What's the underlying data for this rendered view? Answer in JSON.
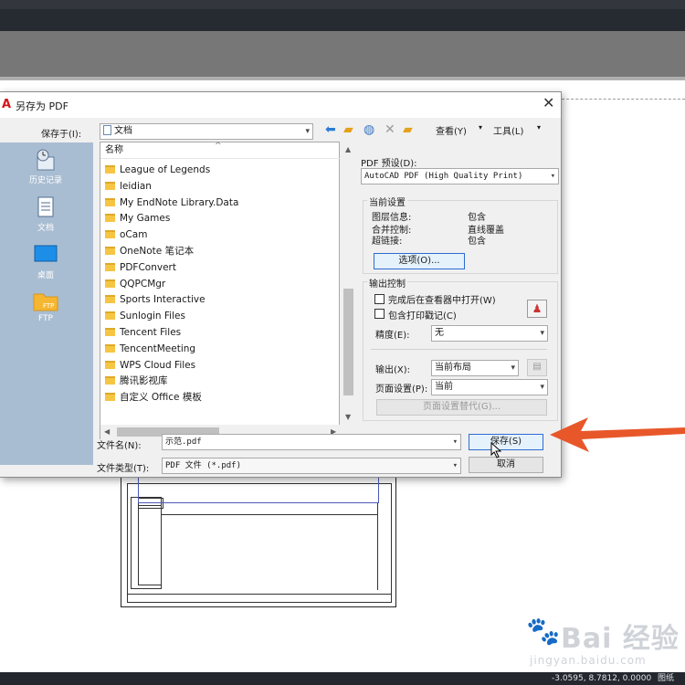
{
  "app": {
    "title": "另存为 PDF",
    "icon": "autocad-a-icon"
  },
  "toolbar": {
    "save_in_label": "保存于(I):",
    "save_in_value": "文档",
    "views_label": "查看(Y)",
    "tools_label": "工具(L)"
  },
  "places": [
    {
      "label": "历史记录",
      "icon": "history-icon"
    },
    {
      "label": "文档",
      "icon": "documents-icon"
    },
    {
      "label": "桌面",
      "icon": "desktop-icon"
    },
    {
      "label": "FTP",
      "icon": "ftp-folder-icon"
    }
  ],
  "file_list": {
    "column_header": "名称",
    "items": [
      "League of Legends",
      "leidian",
      "My EndNote Library.Data",
      "My Games",
      "oCam",
      "OneNote 笔记本",
      "PDFConvert",
      "QQPCMgr",
      "Sports Interactive",
      "Sunlogin Files",
      "Tencent Files",
      "TencentMeeting",
      "WPS Cloud Files",
      "腾讯影视库",
      "自定义 Office 模板"
    ]
  },
  "pdf_preset": {
    "label": "PDF 预设(D):",
    "value": "AutoCAD PDF (High Quality Print)"
  },
  "current_settings": {
    "title": "当前设置",
    "rows": [
      {
        "key": "图层信息:",
        "value": "包含"
      },
      {
        "key": "合并控制:",
        "value": "直线覆盖"
      },
      {
        "key": "超链接:",
        "value": "包含"
      }
    ],
    "options_button": "选项(O)..."
  },
  "output_control": {
    "title": "输出控制",
    "open_in_viewer": "完成后在查看器中打开(W)",
    "include_plot_stamp": "包含打印戳记(C)",
    "precision_label": "精度(E):",
    "precision_value": "无",
    "output_label": "输出(X):",
    "output_value": "当前布局",
    "page_setup_label": "页面设置(P):",
    "page_setup_value": "当前",
    "page_setup_override": "页面设置替代(G)..."
  },
  "filename": {
    "label": "文件名(N):",
    "value": "示范.pdf"
  },
  "filetype": {
    "label": "文件类型(T):",
    "value": "PDF 文件 (*.pdf)"
  },
  "buttons": {
    "save": "保存(S)",
    "cancel": "取消"
  },
  "statusbar": {
    "coords": "-3.0595, 8.7812, 0.0000",
    "model": "图纸"
  },
  "watermark": {
    "brand": "Bai 经验",
    "sub": "jingyan.baidu.com"
  },
  "annotation": {
    "arrow_color": "#e8572a"
  }
}
